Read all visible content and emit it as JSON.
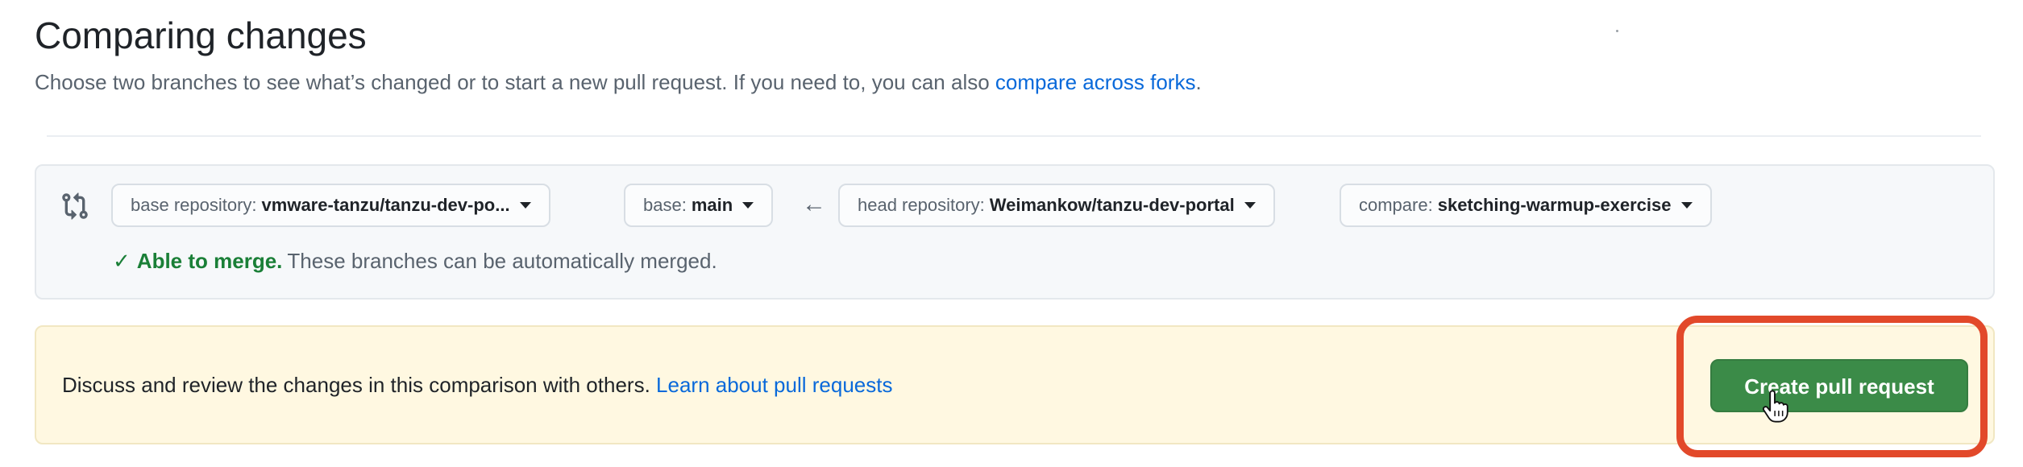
{
  "header": {
    "title": "Comparing changes",
    "subtitle_prefix": "Choose two branches to see what’s changed or to start a new pull request. If you need to, you can also ",
    "subtitle_link": "compare across forks",
    "subtitle_suffix": "."
  },
  "range": {
    "base_repository": {
      "label": "base repository:",
      "value": "vmware-tanzu/tanzu-dev-po..."
    },
    "base_branch": {
      "label": "base:",
      "value": "main"
    },
    "arrow": "←",
    "head_repository": {
      "label": "head repository:",
      "value": "Weimankow/tanzu-dev-portal"
    },
    "compare_branch": {
      "label": "compare:",
      "value": "sketching-warmup-exercise"
    },
    "merge_status": {
      "icon": "check-icon",
      "status": "Able to merge.",
      "message": "These branches can be automatically merged."
    }
  },
  "flash": {
    "text": "Discuss and review the changes in this comparison with others.",
    "link": "Learn about pull requests",
    "button": "Create pull request"
  },
  "colors": {
    "link": "#0969da",
    "success": "#1a7f37",
    "button": "#3b8b48",
    "highlight": "#e2492a",
    "flash_bg": "#fff8e1"
  }
}
